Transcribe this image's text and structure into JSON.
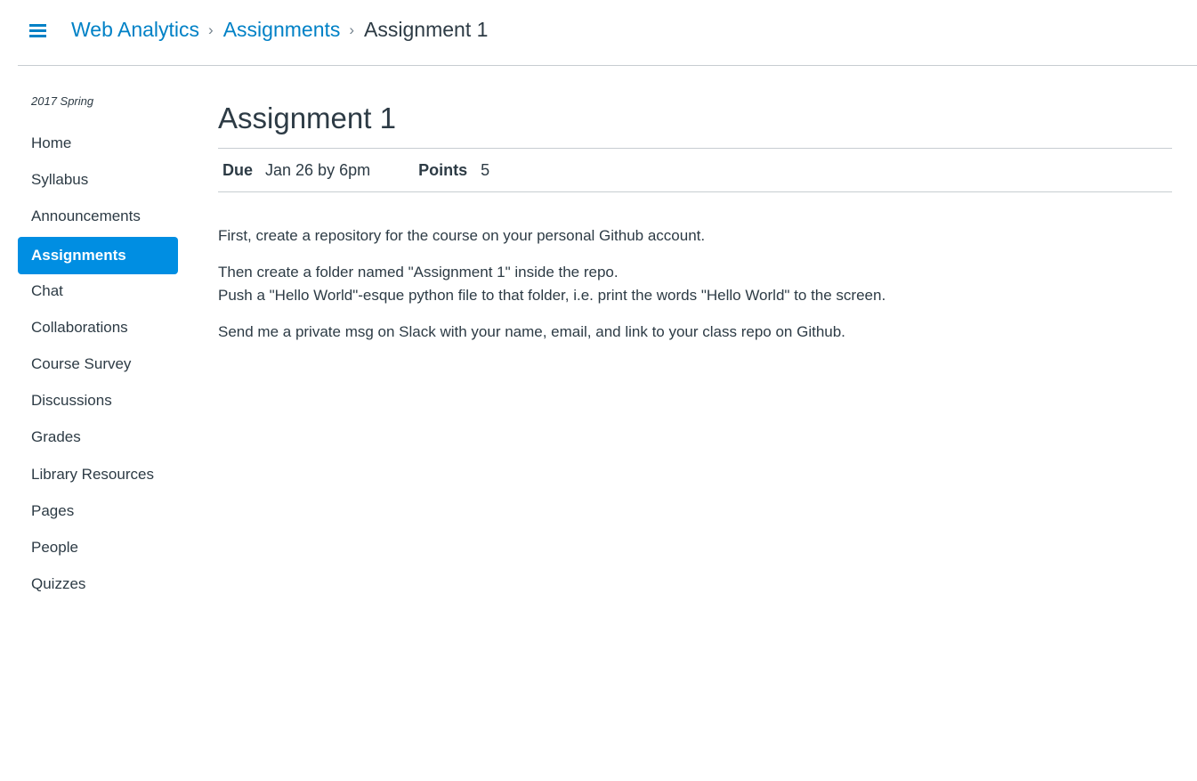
{
  "header": {
    "menu_icon": "hamburger-icon",
    "breadcrumbs": [
      {
        "label": "Web Analytics"
      },
      {
        "label": "Assignments"
      },
      {
        "label": "Assignment 1"
      }
    ],
    "separator_icon": "chevron-right-icon",
    "link_color": "#0081c6"
  },
  "sidebar": {
    "term": "2017 Spring",
    "items": [
      {
        "label": "Home"
      },
      {
        "label": "Syllabus"
      },
      {
        "label": "Announcements"
      },
      {
        "label": "Assignments",
        "active": true
      },
      {
        "label": "Chat"
      },
      {
        "label": "Collaborations"
      },
      {
        "label": "Course Survey"
      },
      {
        "label": "Discussions"
      },
      {
        "label": "Grades"
      },
      {
        "label": "Library Resources"
      },
      {
        "label": "Pages"
      },
      {
        "label": "People"
      },
      {
        "label": "Quizzes"
      }
    ],
    "active_color": "#008ee2"
  },
  "assignment": {
    "title": "Assignment 1",
    "due_label": "Due",
    "due_value": "Jan 26 by 6pm",
    "points_label": "Points",
    "points_value": "5",
    "description": {
      "p1": "First, create a repository for the course on your personal Github account.",
      "p2_line1": "Then create a folder named \"Assignment 1\" inside the repo.",
      "p2_line2": "Push a \"Hello World\"-esque python file to that folder, i.e. print the words \"Hello World\" to the screen.",
      "p3": "Send me a private msg on Slack with your name, email, and link to your class repo on Github."
    }
  }
}
